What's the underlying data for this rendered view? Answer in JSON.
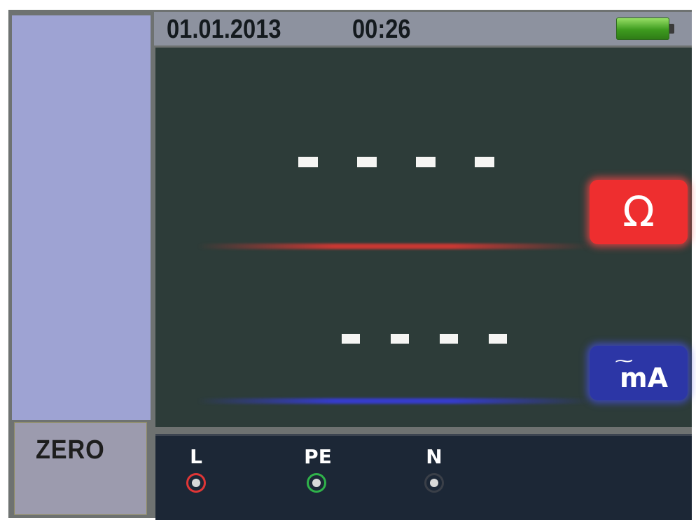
{
  "header": {
    "date": "01.01.2013",
    "time": "00:26",
    "battery_icon": "battery-full-icon",
    "battery_color": "#3e9b1f"
  },
  "sidebar": {
    "zero_label": "ZERO"
  },
  "display": {
    "primary_reading": "- - - -",
    "primary_unit": "Ω",
    "primary_unit_color": "#ee2e2f",
    "secondary_reading": "- - - -",
    "secondary_unit": "mA",
    "secondary_unit_prefix": "~",
    "secondary_unit_color": "#2c36a6"
  },
  "terminals": [
    {
      "label": "L",
      "ring_color": "#e03636"
    },
    {
      "label": "PE",
      "ring_color": "#2fb24a"
    },
    {
      "label": "N",
      "ring_color": "#3a3f48"
    }
  ]
}
